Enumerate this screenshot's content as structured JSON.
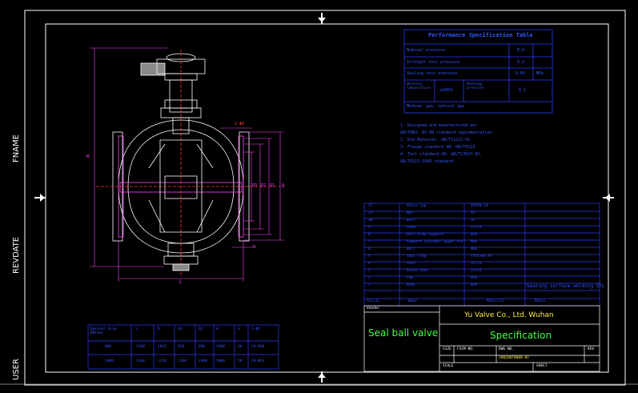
{
  "margin_labels": {
    "fname": "FNAME",
    "revdate": "REVDATE",
    "user": "USER"
  },
  "colors": {
    "background": "#000000",
    "frame": "#ffffff",
    "table_blue": "#2a3cff",
    "text_blue": "#3355ff",
    "title_yellow": "#ffee44",
    "title_green": "#44ff44",
    "geometry_white": "#ffffff",
    "dimension_magenta": "#ff44ff",
    "marker_red": "#ff3333"
  },
  "performance_table": {
    "title": "Performance Specification Table",
    "rows": [
      {
        "label": "Nominal pressure",
        "value": "0.6",
        "unit": ""
      },
      {
        "label": "Strength test pressure",
        "value": "0.9",
        "unit": ""
      },
      {
        "label": "Sealing test pressure",
        "value": "0.66",
        "unit": "MPa"
      }
    ],
    "mid_row": {
      "label_a": "Working temperature",
      "value_a": "≤200℃",
      "label_b": "Working pressure",
      "value_b": "0.1"
    },
    "medium": "Medium: gas, natural gas"
  },
  "notes": [
    "1. Designed and manufactured per",
    "   GB/T983, BS-EN standard implementation",
    "2. End Material: GB/T12221-91",
    "3. Flange standard GB: GB/T9113",
    "4. Test standard GB: GB/T13927-92,",
    "   GB/T9113-1999 standard"
  ],
  "dimension_labels": [
    "H",
    "D",
    "D1",
    "D2",
    "D3",
    "L",
    "Z-Φd",
    "b"
  ],
  "parts_table": {
    "rows": [
      {
        "no": "12",
        "name": "Valve cap",
        "material": "QT450-10",
        "note": ""
      },
      {
        "no": "11",
        "name": "Nut",
        "material": "45",
        "note": ""
      },
      {
        "no": "10",
        "name": "Bolt",
        "material": "35",
        "note": ""
      },
      {
        "no": "9",
        "name": "Stem",
        "material": "2Cr13",
        "note": ""
      },
      {
        "no": "8",
        "name": "Anti-flow support",
        "material": "WCB",
        "note": ""
      },
      {
        "no": "7",
        "name": "Support cylinder upper fix",
        "material": "WCB",
        "note": ""
      },
      {
        "no": "6",
        "name": "Ball",
        "material": "WCB",
        "note": ""
      },
      {
        "no": "5",
        "name": "Seal ring",
        "material": "PTFE+Bt-PE",
        "note": ""
      },
      {
        "no": "4",
        "name": "Seat",
        "material": "2Cr13",
        "note": ""
      },
      {
        "no": "3",
        "name": "Valve seat",
        "material": "2Cr13",
        "note": ""
      },
      {
        "no": "2",
        "name": "Cap",
        "material": "WCB",
        "note": ""
      },
      {
        "no": "1",
        "name": "Body",
        "material": "WCB",
        "note": "Sealing surface welding STL"
      }
    ],
    "header": {
      "no": "Serial",
      "name": "Name",
      "material": "Material",
      "note": "Notes"
    }
  },
  "title_block": {
    "vendor_label": "Vendor",
    "company": "Yu Valve Co., Ltd. Wuhan",
    "product": "Seal ball valve",
    "doc_type": "Specification",
    "size_label": "SIZE",
    "fscm_label": "FSCM NO.",
    "dwg_label": "DWG NO.",
    "dwg_no": "JHQ1HGF0000-01",
    "rev_label": "REV",
    "scale_label": "SCALE",
    "sheet_label": "SHEET"
  },
  "dimension_table": {
    "headers": [
      "Nominal Size DN(mm)",
      "L",
      "D",
      "D1",
      "D2",
      "H",
      "b",
      "Z-Φd"
    ],
    "rows": [
      [
        "800",
        "1100",
        "1015",
        "950",
        "890",
        "1600",
        "40",
        "24-Φ30"
      ],
      [
        "1000",
        "1300",
        "1230",
        "1160",
        "1090",
        "1900",
        "50",
        "28-Φ33"
      ]
    ]
  }
}
